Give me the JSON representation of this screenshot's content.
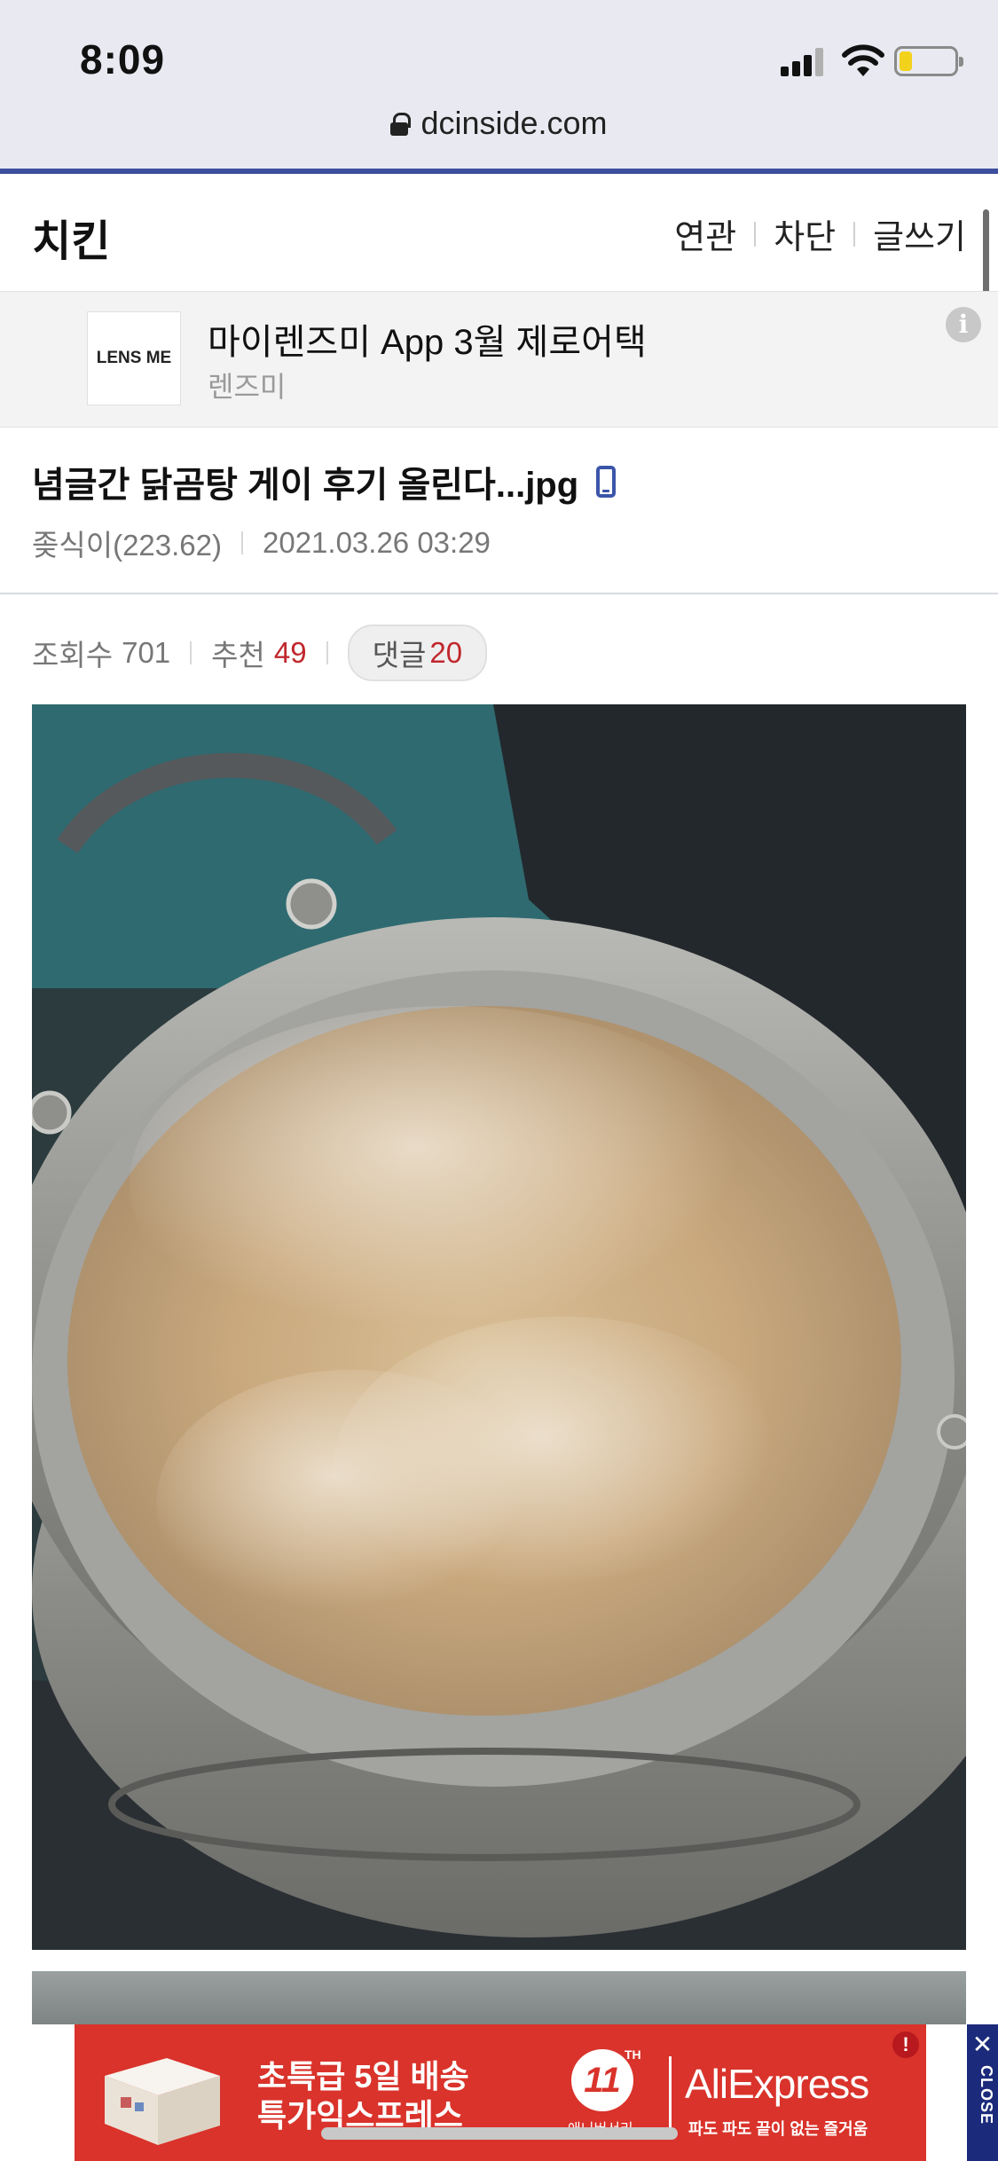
{
  "status_bar": {
    "time": "8:09"
  },
  "browser": {
    "url": "dcinside.com"
  },
  "gallery": {
    "title": "치킨",
    "nav": [
      "연관",
      "차단",
      "글쓰기"
    ]
  },
  "sponsored": {
    "logo_text": "LENS ME",
    "title": "마이렌즈미 App 3월 제로어택",
    "advertiser": "렌즈미",
    "info_icon": "i"
  },
  "post": {
    "title": "념글간 닭곰탕 게이 후기 올린다...jpg",
    "author": "좆식이(223.62)",
    "date": "2021.03.26 03:29",
    "views_label": "조회수",
    "views": "701",
    "recommend_label": "추천",
    "recommend": "49",
    "comments_label": "댓글",
    "comments": "20"
  },
  "bottom_ad": {
    "line1": "초특급 5일 배송",
    "line2": "특가익스프레스",
    "eleven": "11",
    "eleven_sup": "TH",
    "anniversary": "애니버서리",
    "brand": "AliExpress",
    "slogan": "파도 파도 끝이 없는 즐거움",
    "alert": "!",
    "close_x": "✕",
    "close_text": "CLOSE"
  },
  "colors": {
    "accent_blue": "#3c4f9e",
    "red": "#c0282d",
    "ad_red": "#d9332b",
    "close_strip": "#1b2a7a"
  },
  "icons": [
    "lock-icon",
    "signal-icon",
    "wifi-icon",
    "battery-icon",
    "info-icon",
    "mobile-phone-icon",
    "close-icon"
  ]
}
